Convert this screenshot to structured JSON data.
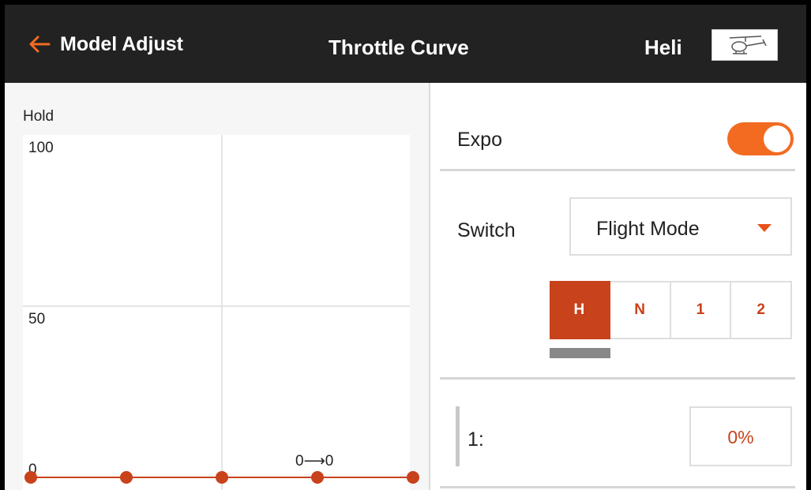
{
  "header": {
    "back_label": "Model Adjust",
    "title": "Throttle Curve",
    "model_type": "Heli",
    "model_icon": "helicopter-icon"
  },
  "graph": {
    "curve_name": "Hold",
    "y_ticks": [
      "100",
      "50"
    ],
    "origin_label": "0",
    "current_readout": "0⟶0"
  },
  "chart_data": {
    "type": "line",
    "title": "Hold",
    "x": [
      0,
      25,
      50,
      75,
      100
    ],
    "series": [
      {
        "values": [
          0,
          0,
          0,
          0,
          0
        ]
      }
    ],
    "ylim": [
      0,
      100
    ],
    "xlim": [
      0,
      100
    ],
    "y_tick_values": [
      100,
      50,
      0
    ],
    "grid": true,
    "point_color": "#c8421b"
  },
  "expo": {
    "label": "Expo",
    "enabled": true
  },
  "switch": {
    "label": "Switch",
    "value": "Flight Mode"
  },
  "mode_tabs": [
    {
      "label": "H",
      "active": true
    },
    {
      "label": "N",
      "active": false
    },
    {
      "label": "1",
      "active": false
    },
    {
      "label": "2",
      "active": false
    }
  ],
  "point": {
    "label": "1:",
    "value": "0%"
  },
  "colors": {
    "accent": "#f26b21",
    "active": "#c8421b",
    "header": "#222222"
  }
}
